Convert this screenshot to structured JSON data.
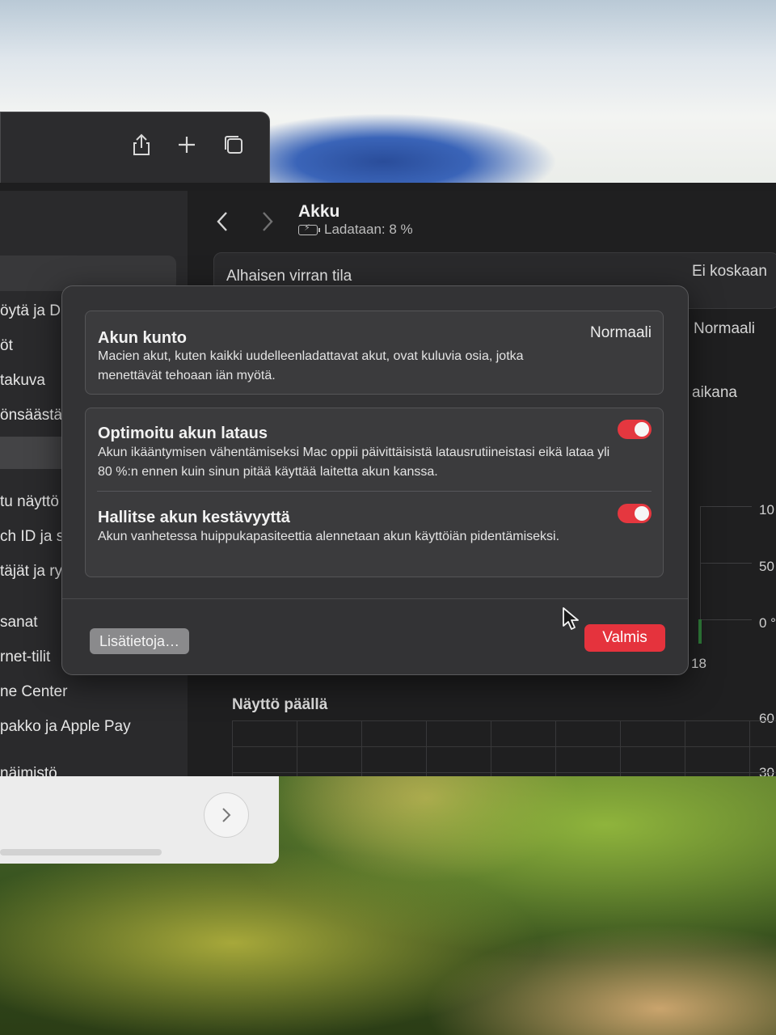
{
  "browser": {
    "share_icon": "share-icon",
    "new_tab_icon": "plus-icon",
    "tabs_icon": "tabs-icon"
  },
  "sidebar": {
    "items": [
      {
        "label": "öytä ja D"
      },
      {
        "label": "öt"
      },
      {
        "label": "takuva"
      },
      {
        "label": "önsäästä"
      },
      {
        "label": "tu näyttö"
      },
      {
        "label": "ch ID ja s"
      },
      {
        "label": "täjät ja ry"
      },
      {
        "label": "sanat"
      },
      {
        "label": "rnet-tilit"
      },
      {
        "label": "ne Center"
      },
      {
        "label": "pakko ja Apple Pay"
      },
      {
        "label": "näimistö"
      }
    ]
  },
  "header": {
    "title": "Akku",
    "status": "Ladataan: 8 %"
  },
  "main": {
    "low_power_label": "Alhaisen virran tila",
    "low_power_value": "Ei koskaan",
    "health_value": "Normaali",
    "partial_label": "aikana",
    "axis_labels": [
      "10",
      "50",
      "0 °",
      "18",
      "60",
      "30"
    ],
    "screen_on_label": "Näyttö päällä"
  },
  "sheet": {
    "health": {
      "title": "Akun kunto",
      "value": "Normaali",
      "description": "Macien akut, kuten kaikki uudelleenladattavat akut, ovat kuluvia osia, jotka menettävät tehoaan iän myötä."
    },
    "optimized": {
      "title": "Optimoitu akun lataus",
      "description": "Akun ikääntymisen vähentämiseksi Mac oppii päivittäisistä latausrutiineistasi eikä lataa yli 80 %:n ennen kuin sinun pitää käyttää laitetta akun kanssa.",
      "enabled": true
    },
    "manage": {
      "title": "Hallitse akun kestävyyttä",
      "description": "Akun vanhetessa huippukapasiteettia alennetaan akun käyttöiän pidentämiseksi.",
      "enabled": true
    },
    "more_button": "Lisätietoja…",
    "done_button": "Valmis"
  },
  "colors": {
    "accent": "#e5333d",
    "sheet_bg": "#333335",
    "card_bg": "#3b3b3d"
  }
}
